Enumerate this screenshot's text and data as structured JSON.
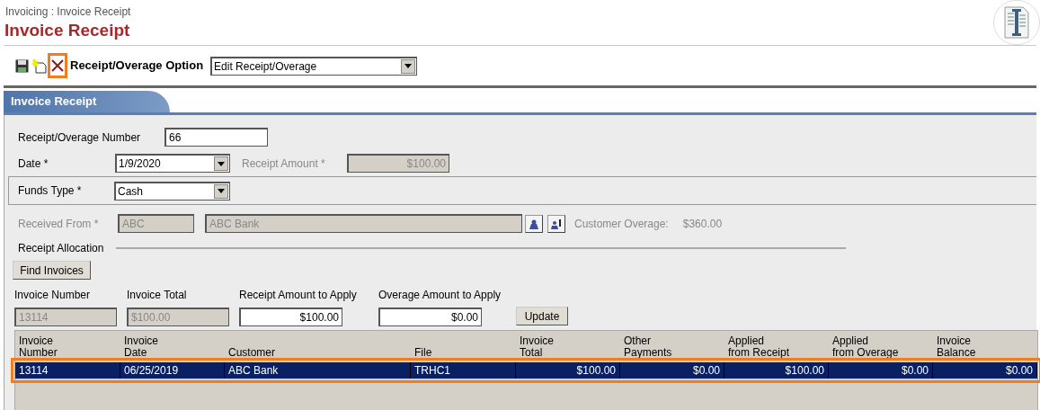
{
  "breadcrumb": "Invoicing : Invoice Receipt",
  "title": "Invoice Receipt",
  "toolbar": {
    "option_label": "Receipt/Overage Option",
    "option_value": "Edit Receipt/Overage",
    "delete_highlighted": true
  },
  "tab": {
    "label": "Invoice Receipt",
    "selected": true
  },
  "form": {
    "receipt_number": {
      "label": "Receipt/Overage Number",
      "value": "66"
    },
    "date": {
      "label": "Date *",
      "value": "1/9/2020"
    },
    "receipt_amount": {
      "label": "Receipt Amount *",
      "value": "$100.00",
      "disabled": true
    },
    "funds_type": {
      "label": "Funds Type *",
      "value": "Cash"
    },
    "received_from": {
      "label": "Received From *",
      "code": "ABC",
      "name": "ABC Bank",
      "disabled": true
    },
    "customer_overage": {
      "label": "Customer Overage:",
      "value": "$360.00"
    }
  },
  "allocation": {
    "label": "Receipt Allocation",
    "find_button": "Find Invoices",
    "update_button": "Update",
    "fields": [
      {
        "label": "Invoice Number",
        "value": "13114",
        "disabled": true
      },
      {
        "label": "Invoice Total",
        "value": "$100.00",
        "disabled": true
      },
      {
        "label": "Receipt Amount to Apply",
        "value": "$100.00",
        "disabled": false
      },
      {
        "label": "Overage Amount to Apply",
        "value": "$0.00",
        "disabled": false
      }
    ]
  },
  "table": {
    "columns": [
      "Invoice Number",
      "Invoice Date",
      "Customer",
      "File",
      "Invoice Total",
      "Other Payments",
      "Applied from Receipt",
      "Applied from Overage",
      "Invoice Balance"
    ],
    "rows": [
      {
        "selected": true,
        "highlighted": true,
        "cells": [
          "13114",
          "06/25/2019",
          "ABC Bank",
          "TRHC1",
          "$100.00",
          "$0.00",
          "$100.00",
          "$0.00",
          "$0.00"
        ]
      }
    ]
  }
}
